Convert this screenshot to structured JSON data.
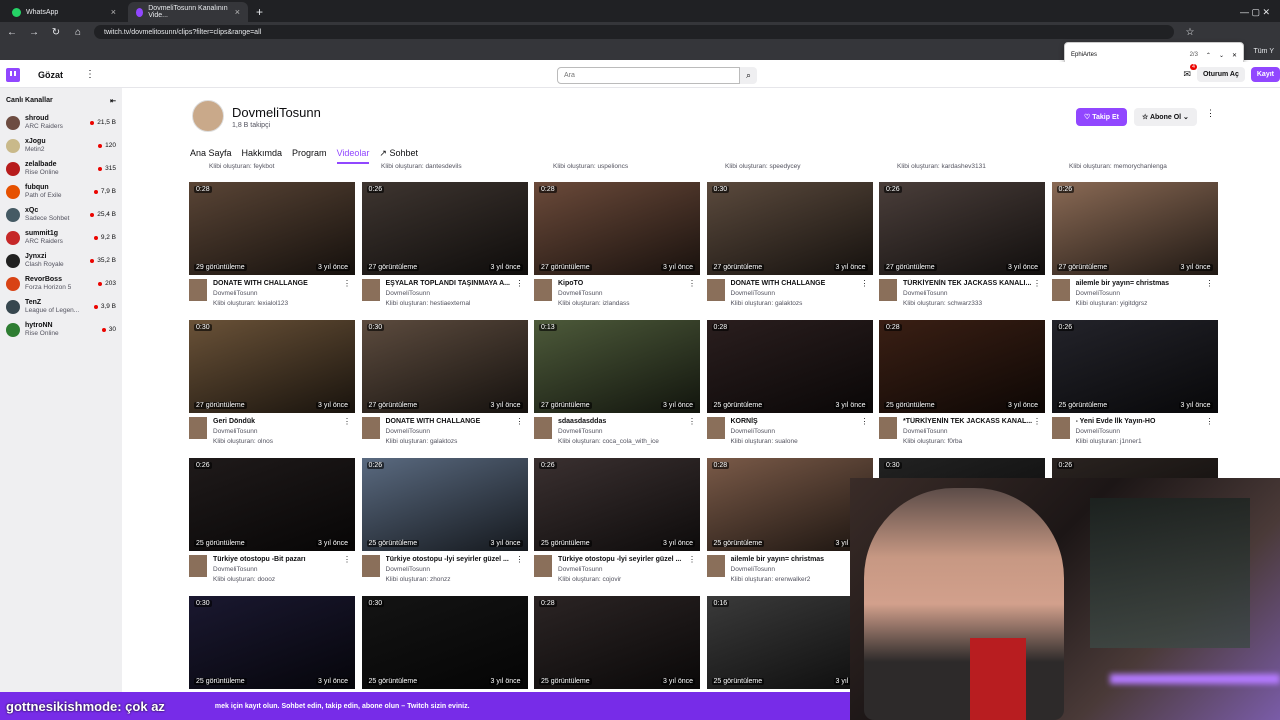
{
  "browser": {
    "tabs": [
      {
        "label": "WhatsApp",
        "color": "#25d366"
      },
      {
        "label": "DovmeliTosunn Kanalının Vide...",
        "color": "#9147ff"
      }
    ],
    "url": "twitch.tv/dovmelitosunn/clips?filter=clips&range=all",
    "profile": "Tüm Y",
    "find": {
      "query": "EphiArtes",
      "count": "2/3"
    }
  },
  "nav": {
    "browse": "Gözat",
    "search_placeholder": "Ara",
    "notif_badge": "4",
    "login": "Oturum Aç",
    "signup": "Kayıt"
  },
  "sidebar": {
    "title": "Canlı Kanallar",
    "items": [
      {
        "name": "shroud",
        "game": "ARC Raiders",
        "viewers": "21,5 B",
        "color": "#6d4c41"
      },
      {
        "name": "xJogu",
        "game": "Metin2",
        "viewers": "120",
        "color": "#c9b98a"
      },
      {
        "name": "zelalbade",
        "game": "Rise Online",
        "viewers": "315",
        "color": "#b71c1c"
      },
      {
        "name": "fubqun",
        "game": "Path of Exile",
        "viewers": "7,9 B",
        "color": "#e65100"
      },
      {
        "name": "xQc",
        "game": "Sadece Sohbet",
        "viewers": "25,4 B",
        "color": "#455a64"
      },
      {
        "name": "summit1g",
        "game": "ARC Raiders",
        "viewers": "9,2 B",
        "color": "#c62828"
      },
      {
        "name": "Jynxzi",
        "game": "Clash Royale",
        "viewers": "35,2 B",
        "color": "#212121"
      },
      {
        "name": "RevorBoss",
        "game": "Forza Horizon 5",
        "viewers": "203",
        "color": "#d84315"
      },
      {
        "name": "TenZ",
        "game": "League of Legen...",
        "viewers": "3,9 B",
        "color": "#37474f"
      },
      {
        "name": "hytroNN",
        "game": "Rise Online",
        "viewers": "30",
        "color": "#2e7d32"
      }
    ]
  },
  "channel": {
    "name": "DovmeliTosunn",
    "followers": "1,8 B takipçi",
    "follow": "Takip Et",
    "subscribe": "Abone Ol",
    "tabs": [
      "Ana Sayfa",
      "Hakkımda",
      "Program",
      "Videolar",
      "Sohbet"
    ]
  },
  "top_row": [
    "Klibi oluşturan: feykbot",
    "Klibi oluşturan: dantesdevils",
    "Klibi oluşturan: uspelioncs",
    "Klibi oluşturan: speedycey",
    "Klibi oluşturan: kardashev3131",
    "Klibi oluşturan: memorychanlenga"
  ],
  "clips": [
    {
      "dur": "0:28",
      "views": "29 görüntüleme",
      "ago": "3 yıl önce",
      "title": "DONATE WITH CHALLANGE",
      "ch": "DovmeliTosunn",
      "by": "Klibi oluşturan: lexialol123",
      "bg": "#5a4536"
    },
    {
      "dur": "0:26",
      "views": "27 görüntüleme",
      "ago": "3 yıl önce",
      "title": "EŞYALAR TOPLANDI TAŞINMAYA A...",
      "ch": "DovmeliTosunn",
      "by": "Klibi oluşturan: hestiaexternal",
      "bg": "#3e3530"
    },
    {
      "dur": "0:28",
      "views": "27 görüntüleme",
      "ago": "3 yıl önce",
      "title": "KipoTO",
      "ch": "DovmeliTosunn",
      "by": "Klibi oluşturan: izlandass",
      "bg": "#6b4a3a"
    },
    {
      "dur": "0:30",
      "views": "27 görüntüleme",
      "ago": "3 yıl önce",
      "title": "DONATE WITH CHALLANGE",
      "ch": "DovmeliTosunn",
      "by": "Klibi oluşturan: galaktozs",
      "bg": "#5b4a3d"
    },
    {
      "dur": "0:26",
      "views": "27 görüntüleme",
      "ago": "3 yıl önce",
      "title": "TÜRKİYENİN TEK JACKASS KANALI...",
      "ch": "DovmeliTosunn",
      "by": "Klibi oluşturan: schwarz333",
      "bg": "#4a3e3a"
    },
    {
      "dur": "0:26",
      "views": "27 görüntüleme",
      "ago": "3 yıl önce",
      "title": "ailemle bir yayın= christmas",
      "ch": "DovmeliTosunn",
      "by": "Klibi oluşturan: yigitdgrsz",
      "bg": "#8a6a55"
    },
    {
      "dur": "0:30",
      "views": "27 görüntüleme",
      "ago": "3 yıl önce",
      "title": "Geri Döndük",
      "ch": "DovmeliTosunn",
      "by": "Klibi oluşturan: olnos",
      "bg": "#6a5238"
    },
    {
      "dur": "0:30",
      "views": "27 görüntüleme",
      "ago": "3 yıl önce",
      "title": "DONATE WITH CHALLANGE",
      "ch": "DovmeliTosunn",
      "by": "Klibi oluşturan: galaktozs",
      "bg": "#5c4b3e"
    },
    {
      "dur": "0:13",
      "views": "27 görüntüleme",
      "ago": "3 yıl önce",
      "title": "sdaasdasddas",
      "ch": "DovmeliTosunn",
      "by": "Klibi oluşturan: coca_cola_with_ice",
      "bg": "#4d5a3a"
    },
    {
      "dur": "0:28",
      "views": "25 görüntüleme",
      "ago": "3 yıl önce",
      "title": "KORNİŞ",
      "ch": "DovmeliTosunn",
      "by": "Klibi oluşturan: sualone",
      "bg": "#2a1e1e"
    },
    {
      "dur": "0:28",
      "views": "25 görüntüleme",
      "ago": "3 yıl önce",
      "title": "*TÜRKİYENİN TEK JACKASS KANAL...",
      "ch": "DovmeliTosunn",
      "by": "Klibi oluşturan: f0rba",
      "bg": "#3a1f14"
    },
    {
      "dur": "0:26",
      "views": "25 görüntüleme",
      "ago": "3 yıl önce",
      "title": "- Yeni Evde İlk Yayın-HO",
      "ch": "DovmeliTosunn",
      "by": "Klibi oluşturan: j1nner1",
      "bg": "#23232a"
    },
    {
      "dur": "0:26",
      "views": "25 görüntüleme",
      "ago": "3 yıl önce",
      "title": "Türkiye otostopu -Bit pazarı",
      "ch": "DovmeliTosunn",
      "by": "Klibi oluşturan: doooz",
      "bg": "#1f1a1a"
    },
    {
      "dur": "0:26",
      "views": "25 görüntüleme",
      "ago": "3 yıl önce",
      "title": "Türkiye otostopu -İyi seyirler güzel ...",
      "ch": "DovmeliTosunn",
      "by": "Klibi oluşturan: zhonzz",
      "bg": "#5a6a80"
    },
    {
      "dur": "0:26",
      "views": "25 görüntüleme",
      "ago": "3 yıl önce",
      "title": "Türkiye otostopu -İyi seyirler güzel ...",
      "ch": "DovmeliTosunn",
      "by": "Klibi oluşturan: cojovir",
      "bg": "#3a3030"
    },
    {
      "dur": "0:28",
      "views": "25 görüntüleme",
      "ago": "3 yıl önce",
      "title": "ailemle bir yayın= christmas",
      "ch": "DovmeliTosunn",
      "by": "Klibi oluşturan: erenwalker2",
      "bg": "#7a5a48"
    },
    {
      "dur": "0:30",
      "views": "",
      "ago": "",
      "title": "",
      "ch": "",
      "by": "",
      "bg": "#222"
    },
    {
      "dur": "0:26",
      "views": "",
      "ago": "",
      "title": "",
      "ch": "",
      "by": "",
      "bg": "#2a2320"
    },
    {
      "dur": "0:30",
      "views": "25 görüntüleme",
      "ago": "3 yıl önce",
      "title": "",
      "ch": "",
      "by": "",
      "bg": "#1a1830"
    },
    {
      "dur": "0:30",
      "views": "25 görüntüleme",
      "ago": "3 yıl önce",
      "title": "",
      "ch": "",
      "by": "",
      "bg": "#141414"
    },
    {
      "dur": "0:28",
      "views": "25 görüntüleme",
      "ago": "3 yıl önce",
      "title": "",
      "ch": "",
      "by": "",
      "bg": "#2b2424"
    },
    {
      "dur": "0:16",
      "views": "25 görüntüleme",
      "ago": "3 yıl önce",
      "title": "",
      "ch": "",
      "by": "",
      "bg": "#3a3a3a"
    }
  ],
  "banner": {
    "name": "gottnesikishmode: çok az",
    "text": "mek için kayıt olun.  Sohbet edin, takip edin, abone olun – Twitch sizin eviniz."
  }
}
